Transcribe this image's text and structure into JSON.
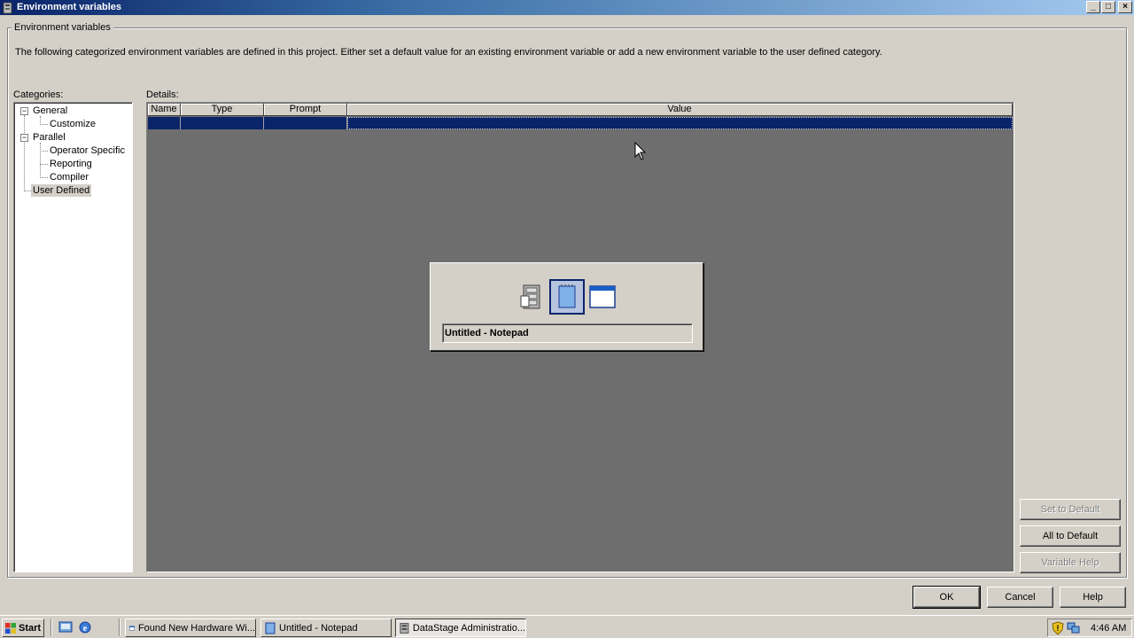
{
  "window": {
    "title": "Environment variables",
    "controls": [
      "_",
      "□",
      "×"
    ]
  },
  "group_label": "Environment variables",
  "description": "The following categorized environment variables are defined in this project.  Either set a default value for an existing environment variable or add a new environment variable to the user defined category.",
  "categories": {
    "label": "Categories:",
    "items": [
      {
        "label": "General",
        "expander": "−"
      },
      {
        "label": "Customize"
      },
      {
        "label": "Parallel",
        "expander": "−"
      },
      {
        "label": "Operator Specific"
      },
      {
        "label": "Reporting"
      },
      {
        "label": "Compiler"
      },
      {
        "label": "User Defined",
        "selected": true
      }
    ]
  },
  "details": {
    "label": "Details:",
    "columns": [
      "Name",
      "Type",
      "Prompt",
      "Value"
    ]
  },
  "buttons": {
    "set_default": "Set to Default",
    "all_default": "All to Default",
    "variable_help": "Variable Help",
    "ok": "OK",
    "cancel": "Cancel",
    "help": "Help"
  },
  "switcher": {
    "selected_name": "Untitled - Notepad",
    "icons": [
      "datastage-icon",
      "notepad-icon",
      "window-icon"
    ]
  },
  "taskbar": {
    "start_label": "Start",
    "tasks": [
      {
        "label": "Found New Hardware Wi..."
      },
      {
        "label": "Untitled - Notepad"
      },
      {
        "label": "DataStage Administratio..."
      }
    ],
    "clock": "4:46 AM"
  },
  "colors": {
    "titlebar": "#0a246a",
    "selection": "#0a246a",
    "grid_bg": "#6e6e6e",
    "face": "#d4d0c8"
  }
}
